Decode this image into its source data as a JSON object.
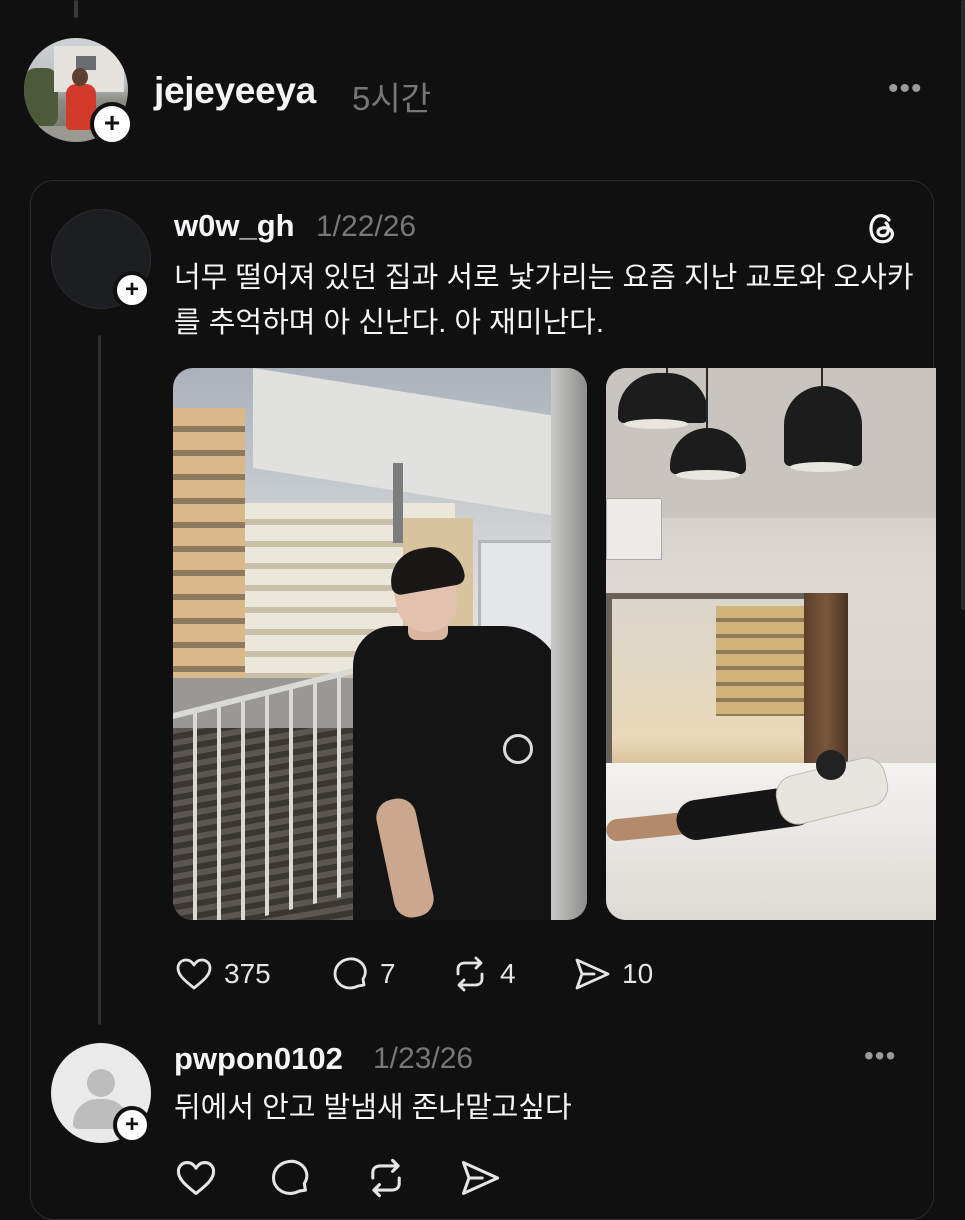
{
  "post": {
    "username": "jejeyeeya",
    "time": "5시간",
    "more": "•••"
  },
  "quoted": {
    "username": "w0w_gh",
    "date": "1/22/26",
    "text": "너무 떨어져 있던 집과 서로 낯가리는 요즘 지난 교토와 오사카를 추억하며 아 신난다. 아 재미난다.",
    "stats": {
      "likes": "375",
      "replies": "7",
      "reposts": "4",
      "shares": "10"
    },
    "icons": [
      "heart-icon",
      "comment-icon",
      "repost-icon",
      "share-icon",
      "threads-logo-icon"
    ]
  },
  "reply": {
    "username": "pwpon0102",
    "date": "1/23/26",
    "text": "뒤에서 안고 발냄새 존나맡고싶다",
    "more": "•••"
  },
  "plus": "+"
}
